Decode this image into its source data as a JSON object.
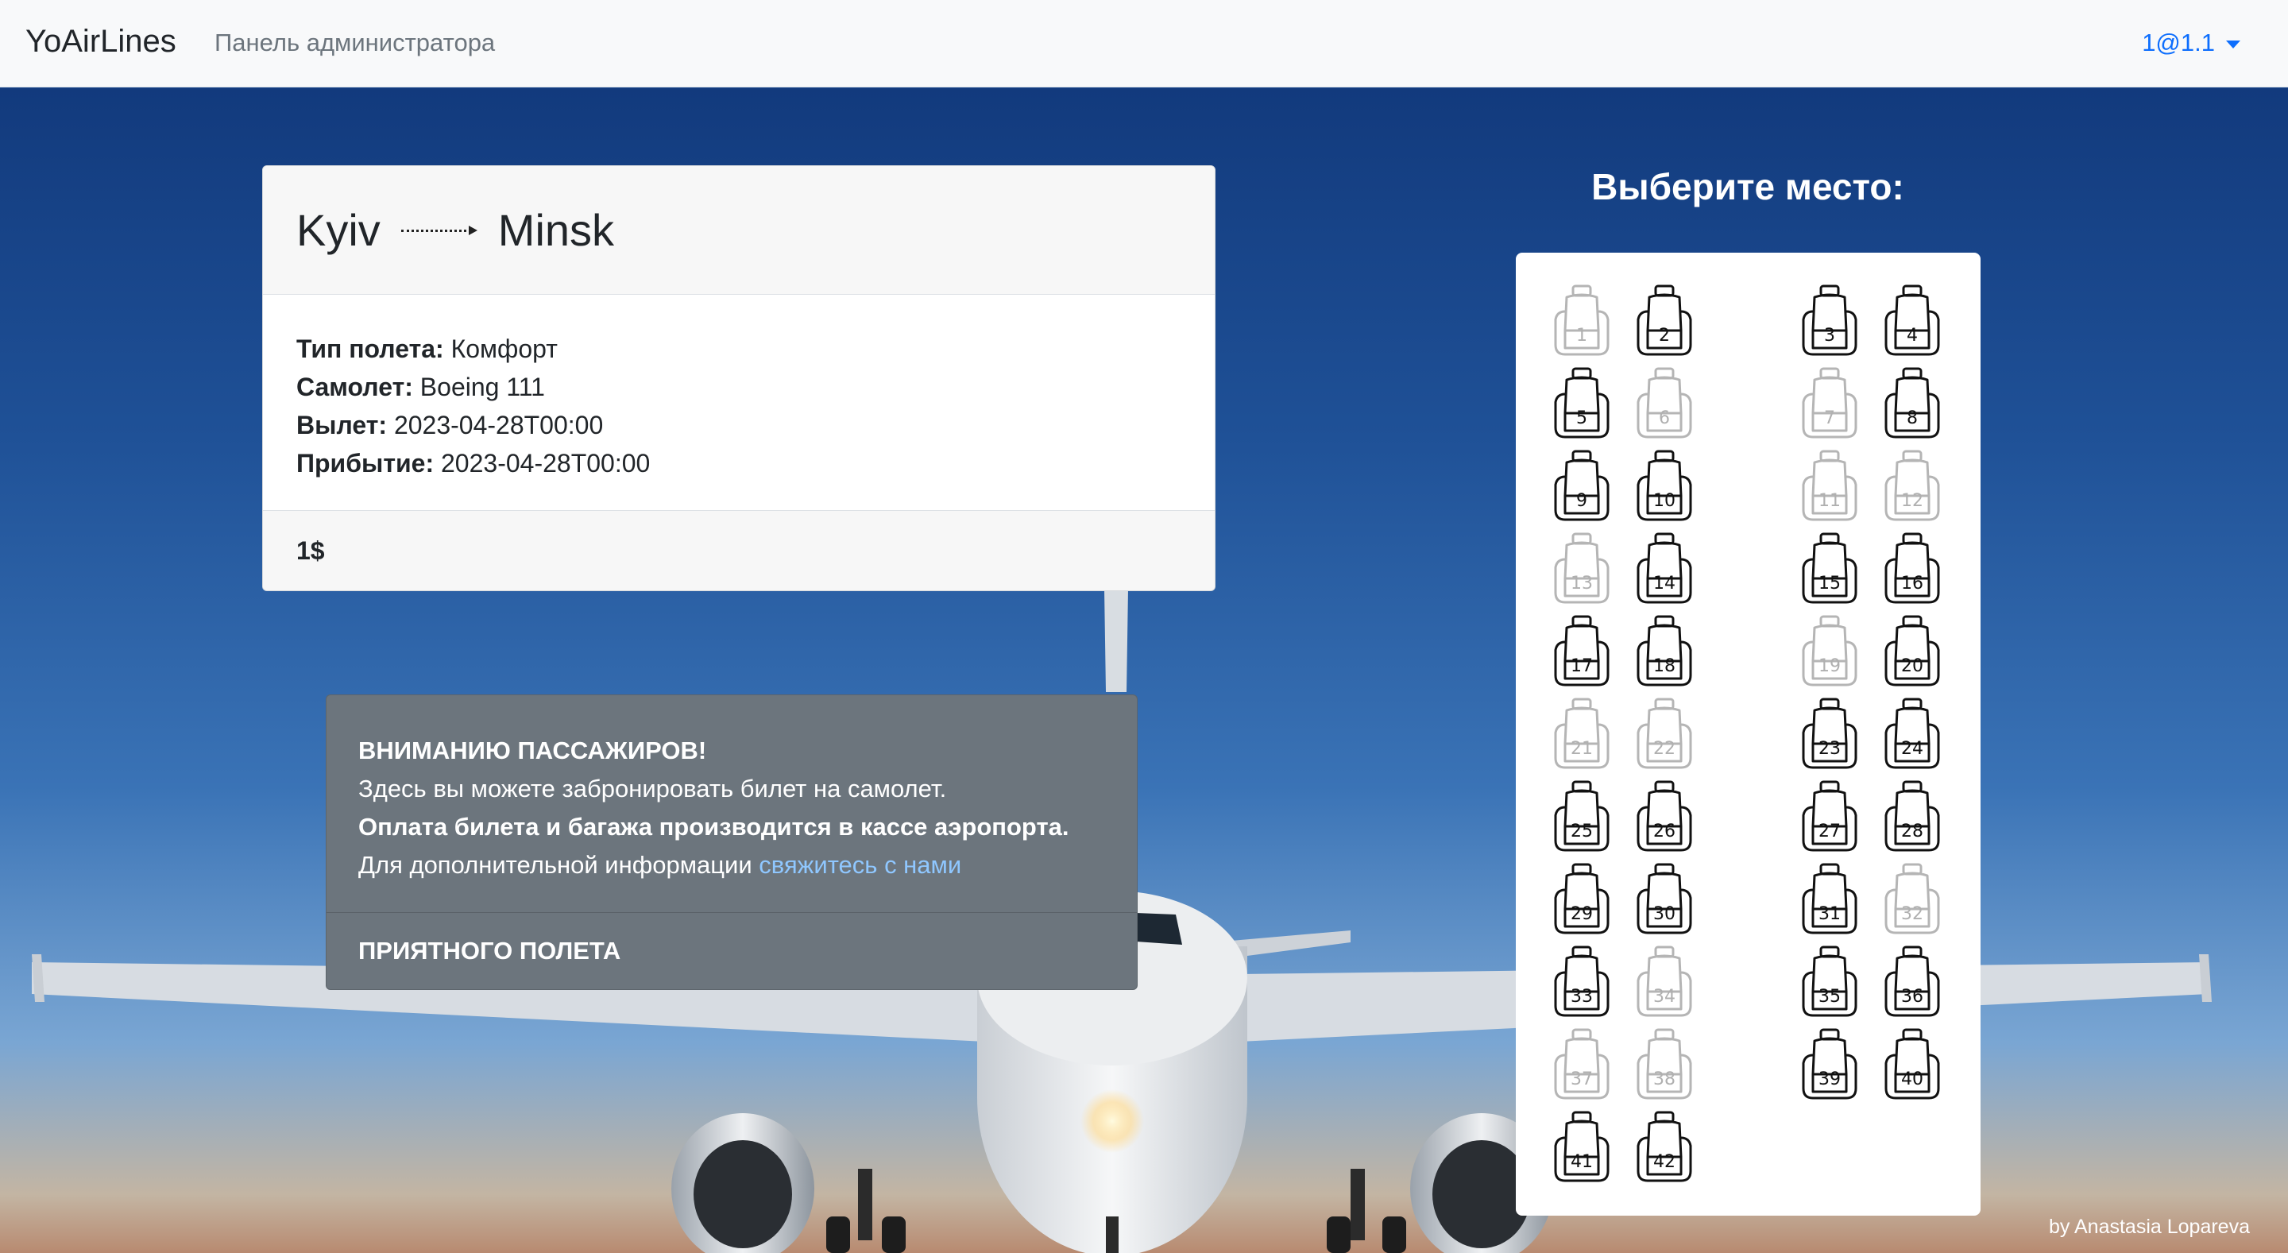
{
  "navbar": {
    "brand": "YoAirLines",
    "admin_link": "Панель администратора",
    "user": "1@1.1"
  },
  "flight": {
    "from": "Kyiv",
    "to": "Minsk",
    "type_label": "Тип полета:",
    "type_value": "Комфорт",
    "plane_label": "Самолет:",
    "plane_value": "Boeing 111",
    "departure_label": "Вылет:",
    "departure_value": "2023-04-28T00:00",
    "arrival_label": "Прибытие:",
    "arrival_value": "2023-04-28T00:00",
    "price": "1$"
  },
  "notice": {
    "title": "ВНИМАНИЮ ПАССАЖИРОВ!",
    "line1": "Здесь вы можете забронировать билет на самолет.",
    "line2": "Оплата билета и багажа производится в кассе аэропорта.",
    "line3_text": "Для дополнительной информации ",
    "line3_link": "свяжитесь с нами",
    "footer": "ПРИЯТНОГО ПОЛЕТА"
  },
  "seat_map": {
    "title": "Выберите место:",
    "seats": [
      {
        "number": "1",
        "available": false
      },
      {
        "number": "2",
        "available": true
      },
      {
        "number": "3",
        "available": true
      },
      {
        "number": "4",
        "available": true
      },
      {
        "number": "5",
        "available": true
      },
      {
        "number": "6",
        "available": false
      },
      {
        "number": "7",
        "available": false
      },
      {
        "number": "8",
        "available": true
      },
      {
        "number": "9",
        "available": true
      },
      {
        "number": "10",
        "available": true
      },
      {
        "number": "11",
        "available": false
      },
      {
        "number": "12",
        "available": false
      },
      {
        "number": "13",
        "available": false
      },
      {
        "number": "14",
        "available": true
      },
      {
        "number": "15",
        "available": true
      },
      {
        "number": "16",
        "available": true
      },
      {
        "number": "17",
        "available": true
      },
      {
        "number": "18",
        "available": true
      },
      {
        "number": "19",
        "available": false
      },
      {
        "number": "20",
        "available": true
      },
      {
        "number": "21",
        "available": false
      },
      {
        "number": "22",
        "available": false
      },
      {
        "number": "23",
        "available": true
      },
      {
        "number": "24",
        "available": true
      },
      {
        "number": "25",
        "available": true
      },
      {
        "number": "26",
        "available": true
      },
      {
        "number": "27",
        "available": true
      },
      {
        "number": "28",
        "available": true
      },
      {
        "number": "29",
        "available": true
      },
      {
        "number": "30",
        "available": true
      },
      {
        "number": "31",
        "available": true
      },
      {
        "number": "32",
        "available": false
      },
      {
        "number": "33",
        "available": true
      },
      {
        "number": "34",
        "available": false
      },
      {
        "number": "35",
        "available": true
      },
      {
        "number": "36",
        "available": true
      },
      {
        "number": "37",
        "available": false
      },
      {
        "number": "38",
        "available": false
      },
      {
        "number": "39",
        "available": true
      },
      {
        "number": "40",
        "available": true
      },
      {
        "number": "41",
        "available": true
      },
      {
        "number": "42",
        "available": true
      }
    ]
  },
  "footer": {
    "credit": "by Anastasia Lopareva"
  }
}
